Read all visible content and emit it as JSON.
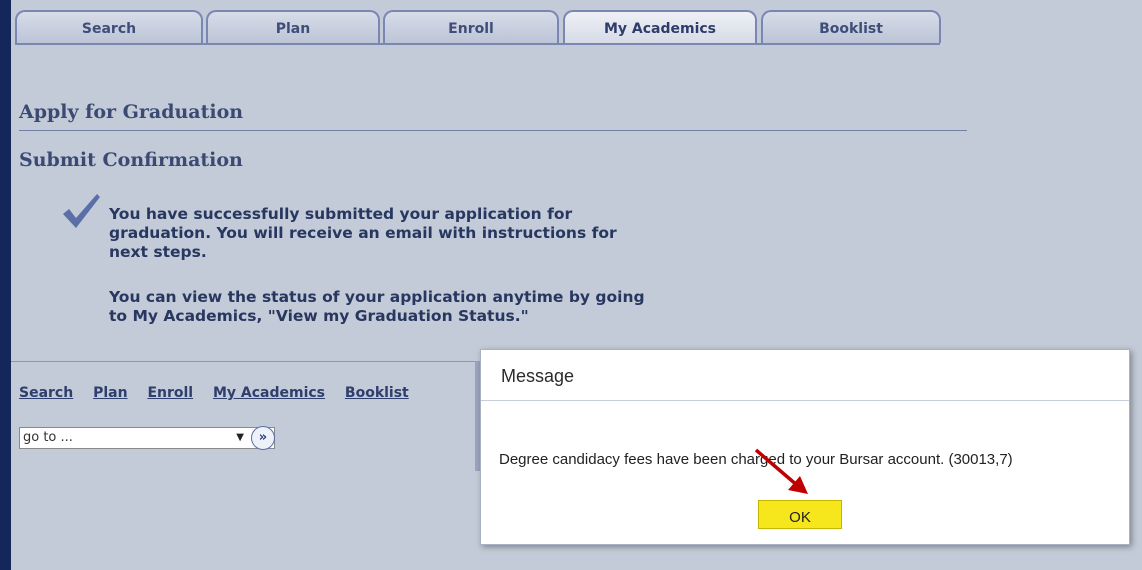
{
  "tabs": [
    {
      "label": "Search"
    },
    {
      "label": "Plan"
    },
    {
      "label": "Enroll"
    },
    {
      "label": "My Academics"
    },
    {
      "label": "Booklist"
    }
  ],
  "heading": "Apply for Graduation",
  "subheading": "Submit Confirmation",
  "confirmation": {
    "line1": "You have successfully submitted your application for graduation. You will receive an email with instructions for next steps.",
    "line2": "You can view the status of your application anytime by going to My Academics, \"View my Graduation Status.\""
  },
  "footer_links": [
    {
      "label": "Search"
    },
    {
      "label": "Plan"
    },
    {
      "label": "Enroll"
    },
    {
      "label": "My Academics"
    },
    {
      "label": "Booklist"
    }
  ],
  "goto_select": {
    "value": "go to ...",
    "go_icon": "double-chevron-right-icon"
  },
  "modal": {
    "title": "Message",
    "text": "Degree candidacy fees have been charged to your Bursar account. (30013,7)",
    "ok_label": "OK"
  },
  "colors": {
    "background": "#14275a",
    "page": "#c3cbd8",
    "ok_button": "#f6e61c",
    "annotation_arrow": "#c00000"
  },
  "icons": {
    "confirmation": "checkmark-icon",
    "annotation": "red-arrow-icon"
  }
}
